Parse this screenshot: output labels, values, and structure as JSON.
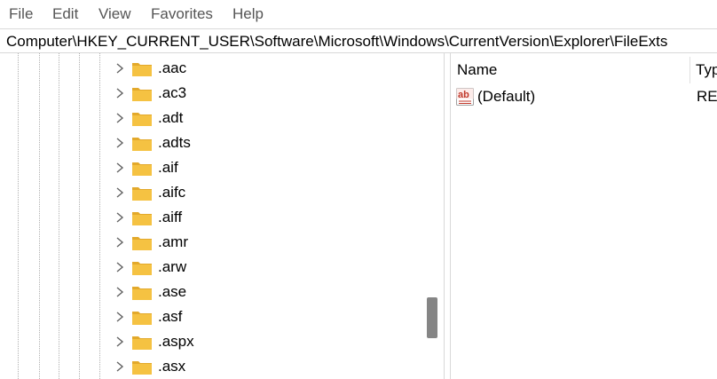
{
  "menu": {
    "items": [
      "File",
      "Edit",
      "View",
      "Favorites",
      "Help"
    ]
  },
  "address": {
    "path": "Computer\\HKEY_CURRENT_USER\\Software\\Microsoft\\Windows\\CurrentVersion\\Explorer\\FileExts"
  },
  "tree": {
    "items": [
      ".aac",
      ".ac3",
      ".adt",
      ".adts",
      ".aif",
      ".aifc",
      ".aiff",
      ".amr",
      ".arw",
      ".ase",
      ".asf",
      ".aspx",
      ".asx"
    ],
    "item_icon": "folder-icon",
    "expander_icon": "chevron-right-icon",
    "scroll_position": 0.75
  },
  "values": {
    "columns": {
      "name": "Name",
      "type": "Typ"
    },
    "rows": [
      {
        "name": "(Default)",
        "type": "REG",
        "icon": "reg-sz-icon"
      }
    ]
  },
  "colors": {
    "folder": "#f5c242",
    "folder_tab": "#e3a92b",
    "reg_icon_red": "#c0392b",
    "scroll_thumb": "#858585"
  }
}
